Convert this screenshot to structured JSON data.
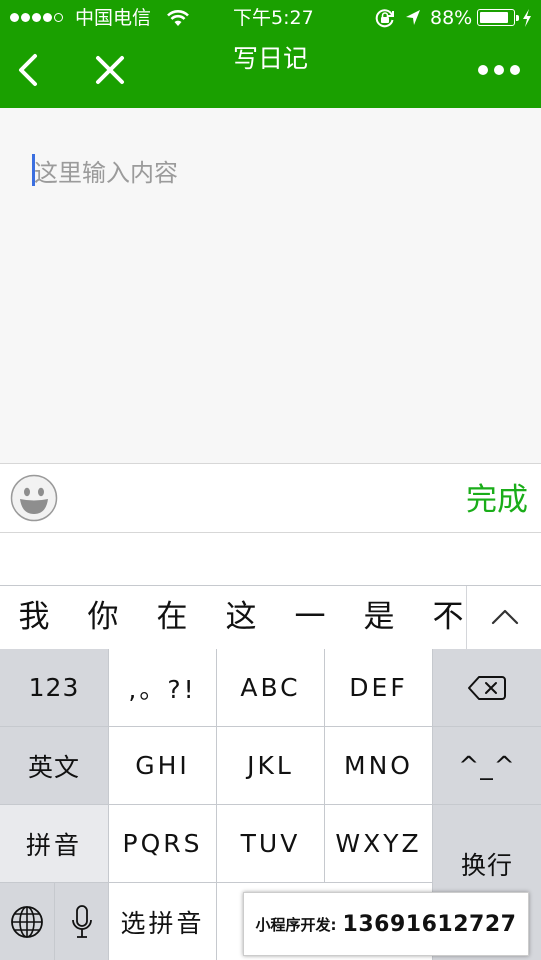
{
  "status_bar": {
    "carrier": "中国电信",
    "time": "下午5:27",
    "battery_percent": "88%",
    "battery_level": 0.88,
    "signal_bars_filled": 4
  },
  "nav": {
    "title": "写日记",
    "back_icon": "chevron-left-icon",
    "close_icon": "close-icon",
    "more_icon": "more-dots-icon"
  },
  "editor": {
    "placeholder": "这里输入内容",
    "value": ""
  },
  "toolbar": {
    "emoji_icon": "emoji-icon",
    "done_label": "完成"
  },
  "candidates": [
    "我",
    "你",
    "在",
    "这",
    "一",
    "是",
    "不"
  ],
  "keyboard": {
    "numbers_key": "123",
    "punct_key": ",。?!",
    "abc_key": "ABC",
    "def_key": "DEF",
    "english_key": "英文",
    "ghi_key": "GHI",
    "jkl_key": "JKL",
    "mno_key": "MNO",
    "emoticon_key": "^_^",
    "pinyin_key": "拼音",
    "pqrs_key": "PQRS",
    "tuv_key": "TUV",
    "wxyz_key": "WXYZ",
    "return_key": "换行",
    "select_pinyin_key": "选拼音"
  },
  "watermark": {
    "label": "小程序开发:",
    "phone": "13691612727"
  },
  "colors": {
    "brand_green": "#1aa000",
    "done_green": "#1aad19",
    "caret_blue": "#3b6fe0"
  }
}
